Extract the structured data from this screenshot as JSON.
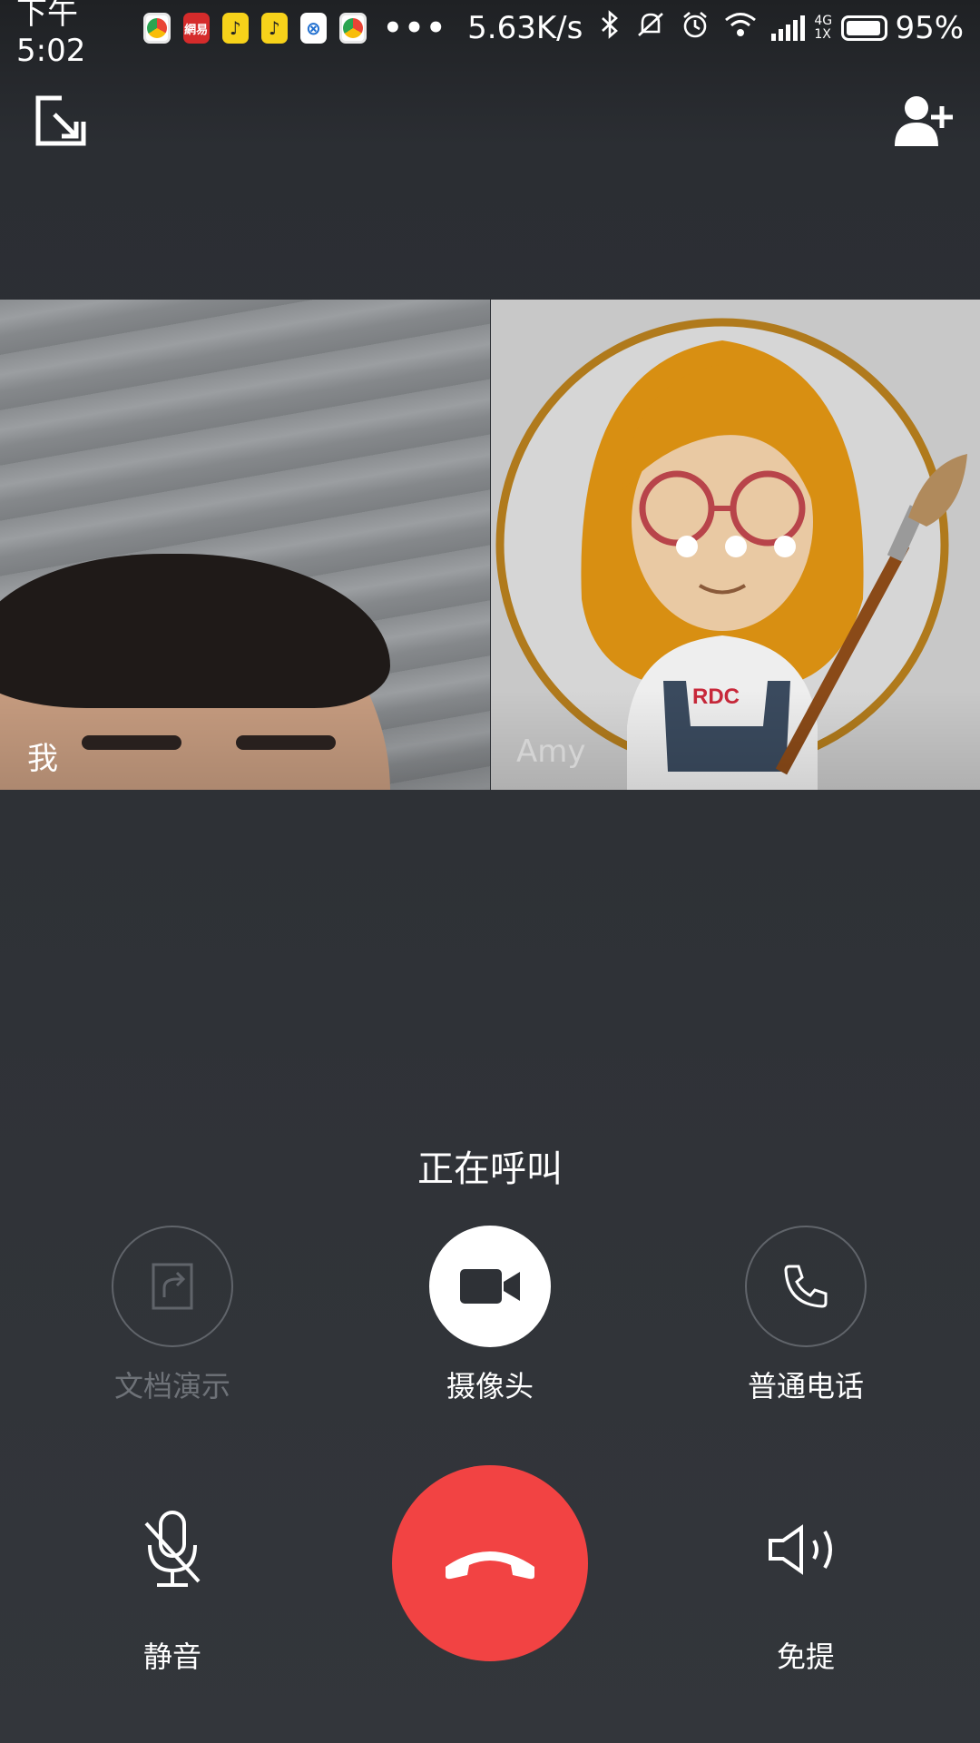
{
  "status_bar": {
    "time": "下午5:02",
    "app_icons": [
      "browser",
      "netease",
      "note",
      "note",
      "circle",
      "browser"
    ],
    "netease_text": "網易",
    "overflow": "•••",
    "net_speed": "5.63K/s",
    "network_type_top": "4G",
    "network_type_bottom": "1X",
    "battery": "95%",
    "battery_level": 0.95
  },
  "top_bar": {
    "minimize_icon": "minimize-window-icon",
    "add_member_icon": "add-person-icon"
  },
  "tiles": {
    "self_label": "我",
    "remote_label": "Amy"
  },
  "call": {
    "status": "正在呼叫"
  },
  "actions": {
    "share_doc": "文档演示",
    "camera": "摄像头",
    "voice_call": "普通电话",
    "mute": "静音",
    "speaker": "免提"
  },
  "colors": {
    "background": "#2b2e33",
    "hangup": "#f24343",
    "disabled_text": "#6e7278"
  }
}
